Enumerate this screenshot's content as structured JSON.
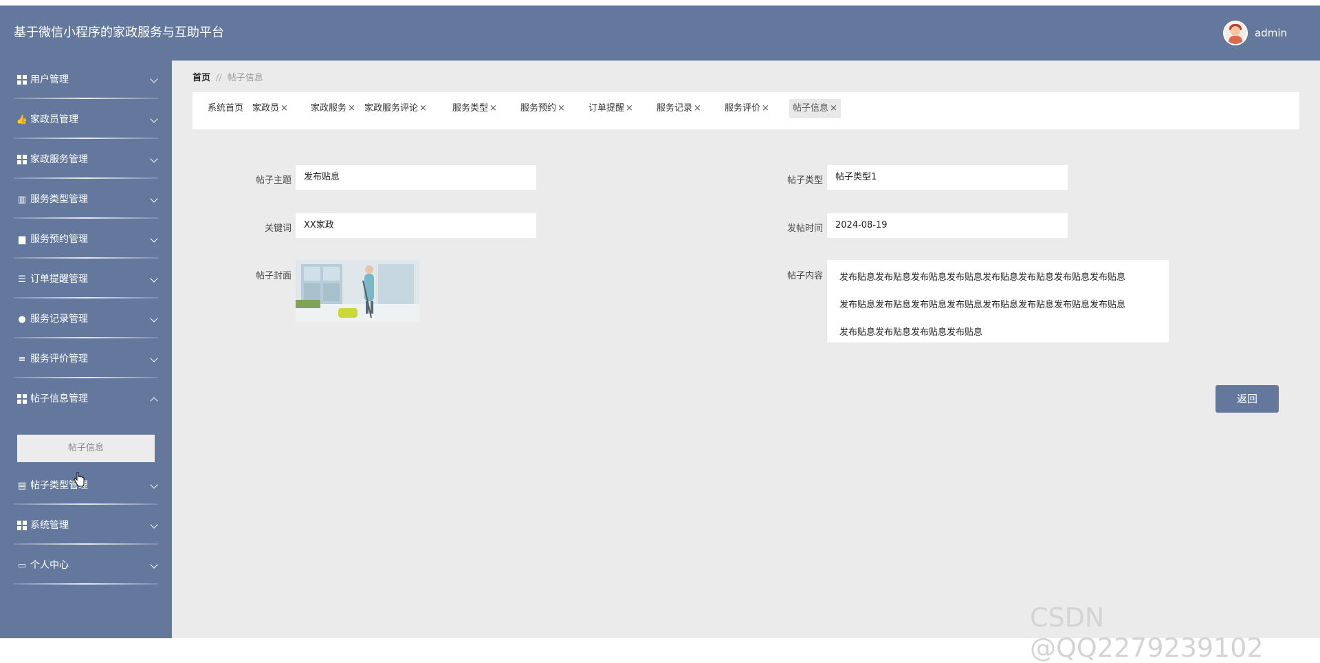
{
  "header": {
    "app_title": "基于微信小程序的家政服务与互助平台",
    "user_name": "admin"
  },
  "sidebar": {
    "items": [
      {
        "label": "用户管理",
        "icon": "grid-icon"
      },
      {
        "label": "家政员管理",
        "icon": "thumbs-up-icon"
      },
      {
        "label": "家政服务管理",
        "icon": "grid-icon"
      },
      {
        "label": "服务类型管理",
        "icon": "books-icon"
      },
      {
        "label": "服务预约管理",
        "icon": "briefcase-icon"
      },
      {
        "label": "订单提醒管理",
        "icon": "sliders-icon"
      },
      {
        "label": "服务记录管理",
        "icon": "lightbulb-icon"
      },
      {
        "label": "服务评价管理",
        "icon": "list-icon"
      },
      {
        "label": "帖子信息管理",
        "icon": "grid-icon"
      },
      {
        "label": "帖子类型管理",
        "icon": "clipboard-icon"
      },
      {
        "label": "系统管理",
        "icon": "grid-icon"
      },
      {
        "label": "个人中心",
        "icon": "window-icon"
      }
    ],
    "submenu_label": "帖子信息"
  },
  "breadcrumb": {
    "home": "首页",
    "separator": "//",
    "current": "帖子信息"
  },
  "tabs": [
    {
      "label": "系统首页",
      "closable": false
    },
    {
      "label": "家政员",
      "closable": true
    },
    {
      "label": "家政服务",
      "closable": true
    },
    {
      "label": "家政服务评论",
      "closable": true
    },
    {
      "label": "服务类型",
      "closable": true
    },
    {
      "label": "服务预约",
      "closable": true
    },
    {
      "label": "订单提醒",
      "closable": true
    },
    {
      "label": "服务记录",
      "closable": true
    },
    {
      "label": "服务评价",
      "closable": true
    },
    {
      "label": "帖子信息",
      "closable": true,
      "active": true
    }
  ],
  "tab_close_symbol": "×",
  "form": {
    "subject_label": "帖子主题",
    "subject_value": "发布贴息",
    "type_label": "帖子类型",
    "type_value": "帖子类型1",
    "keyword_label": "关键词",
    "keyword_value": "XX家政",
    "time_label": "发帖时间",
    "time_value": "2024-08-19",
    "cover_label": "帖子封面",
    "content_label": "帖子内容",
    "content_lines": [
      "发布贴息发布贴息发布贴息发布贴息发布贴息发布贴息发布贴息发布贴息",
      "发布贴息发布贴息发布贴息发布贴息发布贴息发布贴息发布贴息发布贴息",
      "发布贴息发布贴息发布贴息发布贴息"
    ]
  },
  "back_button_label": "返回",
  "watermark": "CSDN @QQ2279239102",
  "colors": {
    "primary": "#64789e",
    "background": "#ebebeb"
  }
}
